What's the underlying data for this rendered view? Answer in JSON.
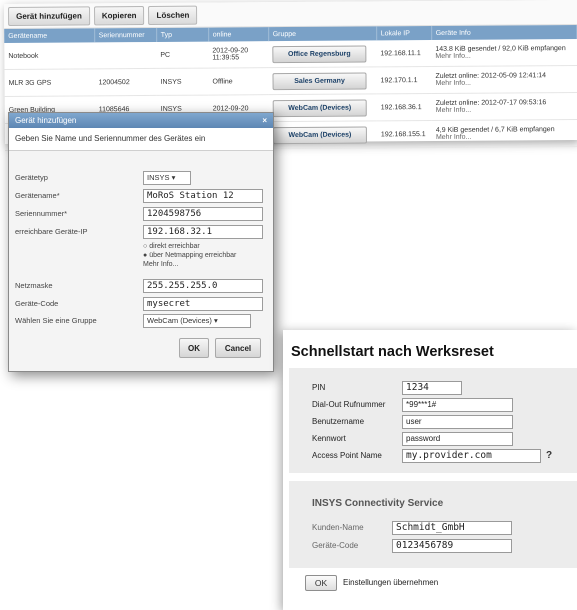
{
  "toolbar": {
    "add_label": "Gerät hinzufügen",
    "copy_label": "Kopieren",
    "delete_label": "Löschen"
  },
  "table": {
    "columns": [
      "Gerätename",
      "Seriennummer",
      "Typ",
      "online",
      "Gruppe",
      "Lokale IP",
      "Geräte Info"
    ],
    "rows": [
      {
        "name": "Notebook",
        "serial": "",
        "type": "PC",
        "online": "2012-09-20 11:39:55",
        "group": "Office Regensburg",
        "ip": "192.168.11.1",
        "info": "143.8 KiB gesendet / 92,0 KiB empfangen",
        "info_more": "Mehr Info..."
      },
      {
        "name": "MLR 3G GPS",
        "serial": "12004502",
        "type": "INSYS",
        "online": "Offline",
        "group": "Sales Germany",
        "ip": "192.170.1.1",
        "info": "Zuletzt online: 2012-05-09 12:41:14",
        "info_more": "Mehr Info..."
      },
      {
        "name": "Green Building",
        "serial": "11085646",
        "type": "INSYS",
        "online": "2012-09-20",
        "group": "WebCam (Devices)",
        "ip": "192.168.36.1",
        "info": "Zuletzt online: 2012-07-17 09:53:16",
        "info_more": "Mehr Info..."
      },
      {
        "name": "",
        "serial": "",
        "type": "",
        "online": "",
        "group": "WebCam (Devices)",
        "ip": "192.168.155.1",
        "info": "4,9 KiB gesendet / 6,7 KiB empfangen",
        "info_more": "Mehr Info..."
      }
    ]
  },
  "dialog": {
    "title": "Gerät hinzufügen",
    "close": "×",
    "intro": "Geben Sie Name und Seriennummer des Gerätes ein",
    "type_label": "Gerätetyp",
    "type_value": "INSYS",
    "name_label": "Gerätename*",
    "name_value": "MoRoS Station 12",
    "serial_label": "Seriennummer*",
    "serial_value": "1204598756",
    "ip_label": "erreichbare Geräte-IP",
    "ip_value": "192.168.32.1",
    "radio1": "direkt erreichbar",
    "radio2": "über Netmapping erreichbar",
    "radio_more": "Mehr Info...",
    "mask_label": "Netzmaske",
    "mask_value": "255.255.255.0",
    "code_label": "Geräte-Code",
    "code_value": "mysecret",
    "group_label": "Wählen Sie eine Gruppe",
    "group_value": "WebCam (Devices)",
    "ok_label": "OK",
    "cancel_label": "Cancel"
  },
  "quickstart": {
    "title": "Schnellstart nach Werksreset",
    "pin_label": "PIN",
    "pin_value": "1234",
    "dialout_label": "Dial-Out Rufnummer",
    "dialout_value": "*99***1#",
    "user_label": "Benutzername",
    "user_value": "user",
    "password_label": "Kennwort",
    "password_value": "password",
    "apn_label": "Access Point Name",
    "apn_value": "my.provider.com",
    "help": "?",
    "service_title": "INSYS Connectivity Service",
    "customer_label": "Kunden-Name",
    "customer_value": "Schmidt_GmbH",
    "devcode_label": "Geräte-Code",
    "devcode_value": "0123456789",
    "ok_label": "OK",
    "apply_label": "Einstellungen übernehmen"
  },
  "colors": {
    "header_blue": "#7aa1c7",
    "title_blue": "#5d86b3",
    "group_text": "#1a3f66"
  }
}
